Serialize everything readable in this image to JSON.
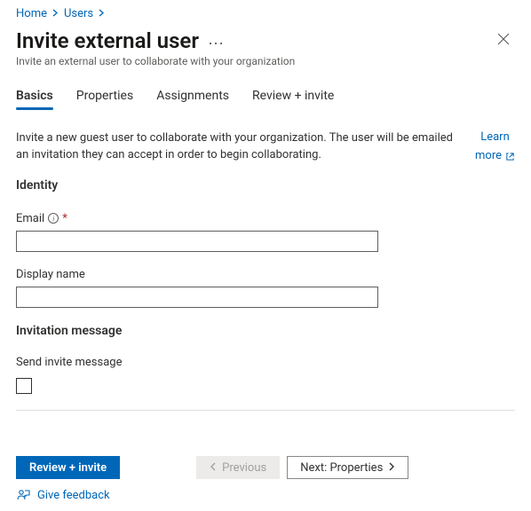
{
  "breadcrumb": {
    "items": [
      {
        "label": "Home"
      },
      {
        "label": "Users"
      }
    ]
  },
  "header": {
    "title": "Invite external user",
    "subtitle": "Invite an external user to collaborate with your organization"
  },
  "tabs": [
    {
      "label": "Basics",
      "active": true
    },
    {
      "label": "Properties",
      "active": false
    },
    {
      "label": "Assignments",
      "active": false
    },
    {
      "label": "Review + invite",
      "active": false
    }
  ],
  "intro": {
    "text": "Invite a new guest user to collaborate with your organization. The user will be emailed an invitation they can accept in order to begin collaborating.",
    "learn_line1": "Learn",
    "learn_line2": "more"
  },
  "sections": {
    "identity": {
      "heading": "Identity",
      "email_label": "Email",
      "email_required_mark": "*",
      "email_value": "",
      "display_name_label": "Display name",
      "display_name_value": ""
    },
    "invitation": {
      "heading": "Invitation message",
      "send_label": "Send invite message",
      "send_checked": false
    }
  },
  "footer": {
    "review_label": "Review + invite",
    "previous_label": "Previous",
    "next_label": "Next: Properties",
    "feedback_label": "Give feedback"
  }
}
